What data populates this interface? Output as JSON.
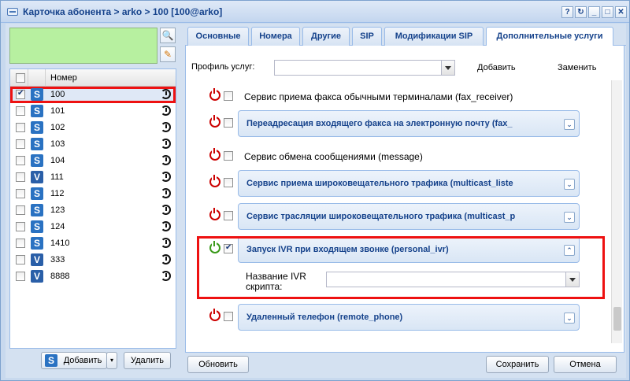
{
  "window": {
    "title": "Карточка абонента > arko > 100 [100@arko]",
    "tools": [
      "?",
      "↻",
      "_",
      "□",
      "✕"
    ]
  },
  "left": {
    "grid_header": "Номер",
    "rows": [
      {
        "num": "100",
        "type": "S",
        "checked": true
      },
      {
        "num": "101",
        "type": "S",
        "checked": false
      },
      {
        "num": "102",
        "type": "S",
        "checked": false
      },
      {
        "num": "103",
        "type": "S",
        "checked": false
      },
      {
        "num": "104",
        "type": "S",
        "checked": false
      },
      {
        "num": "111",
        "type": "V",
        "checked": false
      },
      {
        "num": "112",
        "type": "S",
        "checked": false
      },
      {
        "num": "123",
        "type": "S",
        "checked": false
      },
      {
        "num": "124",
        "type": "S",
        "checked": false
      },
      {
        "num": "1410",
        "type": "S",
        "checked": false
      },
      {
        "num": "333",
        "type": "V",
        "checked": false
      },
      {
        "num": "8888",
        "type": "V",
        "checked": false
      }
    ],
    "add_label": "Добавить",
    "delete_label": "Удалить"
  },
  "tabs": [
    "Основные",
    "Номера",
    "Другие",
    "SIP",
    "Модификации SIP",
    "Дополнительные услуги"
  ],
  "profile": {
    "label": "Профиль услуг:",
    "value": "",
    "add_label": "Добавить",
    "replace_label": "Заменить"
  },
  "services": [
    {
      "title": "Сервис приема факса обычными терминалами (fax_receiver)",
      "fieldset": false,
      "on": false
    },
    {
      "title": "Переадресация входящего факса на электронную почту (fax_",
      "fieldset": true,
      "on": false
    },
    {
      "title": "Сервис обмена сообщениями (message)",
      "fieldset": false,
      "on": false
    },
    {
      "title": "Сервис приема широковещательного трафика (multicast_liste",
      "fieldset": true,
      "on": false
    },
    {
      "title": "Сервис трасляции широковещательного трафика (multicast_p",
      "fieldset": true,
      "on": false
    },
    {
      "title": "Запуск IVR при входящем звонке (personal_ivr)",
      "fieldset": true,
      "on": true,
      "expanded": true
    },
    {
      "title": "Удаленный телефон (remote_phone)",
      "fieldset": true,
      "on": false
    }
  ],
  "ivr": {
    "label_line1": "Название IVR",
    "label_line2": "скрипта:",
    "value": ""
  },
  "footer": {
    "refresh_label": "Обновить",
    "save_label": "Сохранить",
    "cancel_label": "Отмена"
  }
}
